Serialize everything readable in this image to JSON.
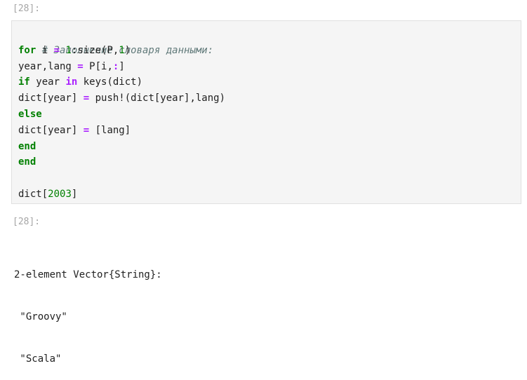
{
  "input_prompt": "[28]:",
  "output_prompt": "[28]:",
  "code": {
    "comment": "# Заполнение словаря данными:",
    "lines": [
      {
        "kw": "for",
        "a": " i ",
        "op": "=",
        "b": " ",
        "num": "1",
        "c": ":size(P,",
        "num2": "1",
        "d": ")"
      },
      {
        "a": "year,lang ",
        "op": "=",
        "b": " P[i,",
        "op2": ":",
        "c": "]"
      },
      {
        "kw": "if",
        "a": " year ",
        "kw2": "in",
        "b": " keys(dict)"
      },
      {
        "a": "dict[year] ",
        "op": "=",
        "b": " push!(dict[year],lang)"
      },
      {
        "kw": "else"
      },
      {
        "a": "dict[year] ",
        "op": "=",
        "b": " [lang]"
      },
      {
        "kw": "end"
      },
      {
        "kw": "end"
      },
      {
        "blank": ""
      },
      {
        "a": "dict[",
        "num": "2003",
        "b": "]"
      }
    ]
  },
  "output": {
    "header": "2-element Vector{String}:",
    "items": [
      " \"Groovy\"",
      " \"Scala\""
    ]
  },
  "colors": {
    "keyword": "#008000",
    "operator": "#aa22ff",
    "number": "#008000",
    "comment": "#617a7a",
    "prompt": "#a6a6a6"
  }
}
